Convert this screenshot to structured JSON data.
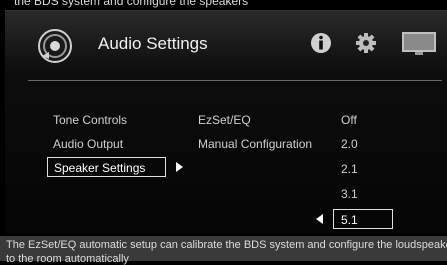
{
  "top_strip_text": "the BDS system and configure the speakers",
  "header": {
    "title": "Audio Settings"
  },
  "menu": [
    {
      "label": "Tone Controls"
    },
    {
      "label": "Audio Output"
    },
    {
      "label": "Speaker Settings",
      "selected": true
    }
  ],
  "submenu": [
    {
      "label": "EzSet/EQ"
    },
    {
      "label": "Manual Configuration"
    }
  ],
  "values": [
    "Off",
    "2.0",
    "2.1",
    "3.1",
    "5.1"
  ],
  "selected_value": "5.1",
  "footer": {
    "line1": "The EzSet/EQ automatic setup can calibrate the BDS system and configure the loudspeakers",
    "line2": "to the room automatically"
  }
}
